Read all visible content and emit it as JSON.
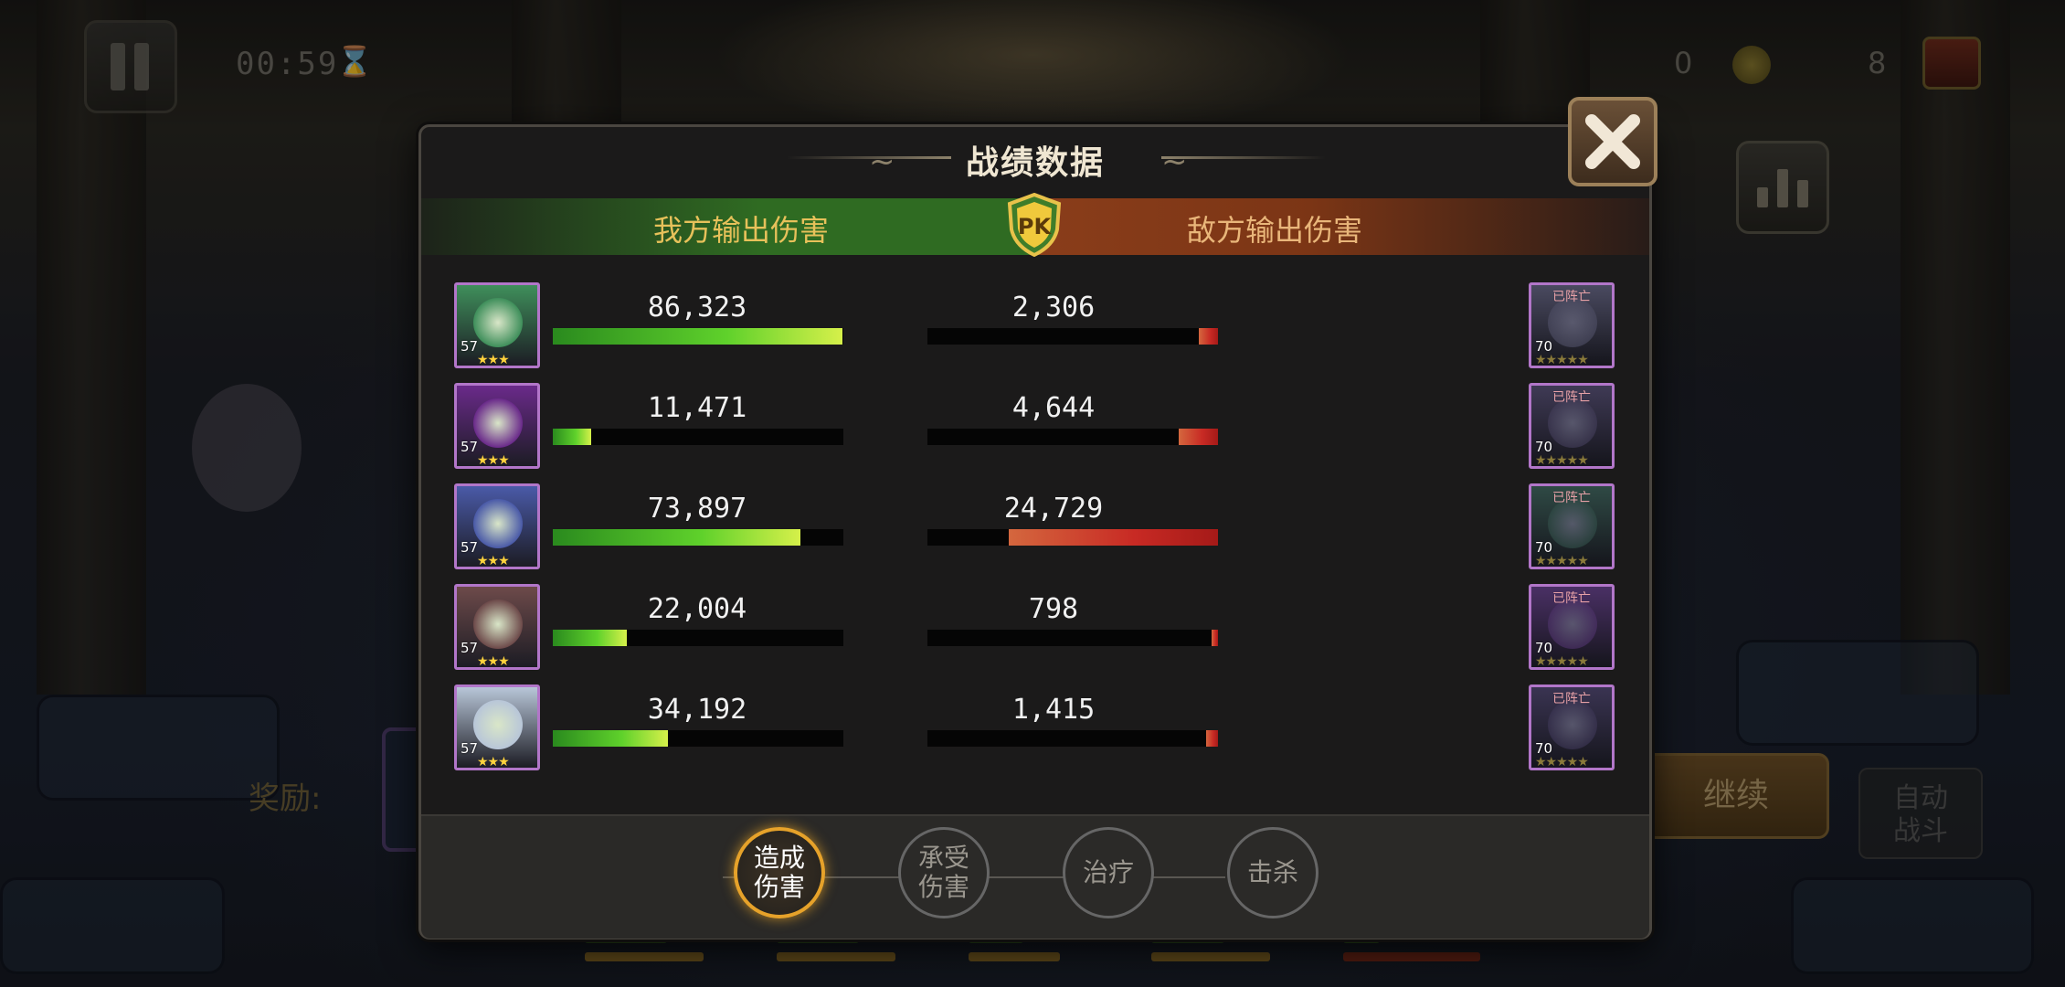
{
  "hud": {
    "timer": "00:59",
    "gold": "0",
    "chests": "8",
    "reward_label": "奖励:",
    "continue_label": "继续",
    "auto_label": "自动战斗"
  },
  "dialog": {
    "title": "战绩数据",
    "ally_header": "我方输出伤害",
    "enemy_header": "敌方输出伤害",
    "pk_label": "PK",
    "dead_label": "已阵亡",
    "tabs": [
      {
        "label": "造成伤害",
        "active": true
      },
      {
        "label": "承受伤害",
        "active": false
      },
      {
        "label": "治疗",
        "active": false
      },
      {
        "label": "击杀",
        "active": false
      }
    ],
    "ally": [
      {
        "level": "57",
        "stars": "★★★",
        "damage": "86,323",
        "value": 86323,
        "color": "#3f8f5b"
      },
      {
        "level": "57",
        "stars": "★★★",
        "damage": "11,471",
        "value": 11471,
        "color": "#6a2a8a"
      },
      {
        "level": "57",
        "stars": "★★★",
        "damage": "73,897",
        "value": 73897,
        "color": "#4a5aa8"
      },
      {
        "level": "57",
        "stars": "★★★",
        "damage": "22,004",
        "value": 22004,
        "color": "#6d4a4a"
      },
      {
        "level": "57",
        "stars": "★★★",
        "damage": "34,192",
        "value": 34192,
        "color": "#b8c6d8"
      }
    ],
    "enemy": [
      {
        "level": "70",
        "stars": "★★★★★",
        "damage": "2,306",
        "value": 2306,
        "color": "#4a4a60"
      },
      {
        "level": "70",
        "stars": "★★★★★",
        "damage": "4,644",
        "value": 4644,
        "color": "#3f3a55"
      },
      {
        "level": "70",
        "stars": "★★★★★",
        "damage": "24,729",
        "value": 24729,
        "color": "#2f4a45"
      },
      {
        "level": "70",
        "stars": "★★★★★",
        "damage": "798",
        "value": 798,
        "color": "#4a3065"
      },
      {
        "level": "70",
        "stars": "★★★★★",
        "damage": "1,415",
        "value": 1415,
        "color": "#3a3452"
      }
    ]
  }
}
